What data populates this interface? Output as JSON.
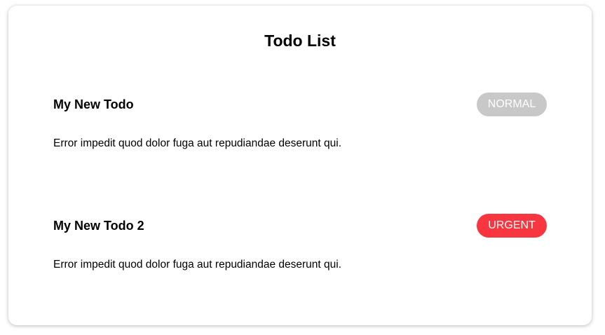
{
  "page": {
    "title": "Todo List"
  },
  "todos": [
    {
      "title": "My New Todo",
      "priority": "NORMAL",
      "priority_color": "#c8c8c8",
      "description": "Error impedit quod dolor fuga aut repudiandae deserunt qui."
    },
    {
      "title": "My New Todo 2",
      "priority": "URGENT",
      "priority_color": "#f7363f",
      "description": "Error impedit quod dolor fuga aut repudiandae deserunt qui."
    }
  ]
}
